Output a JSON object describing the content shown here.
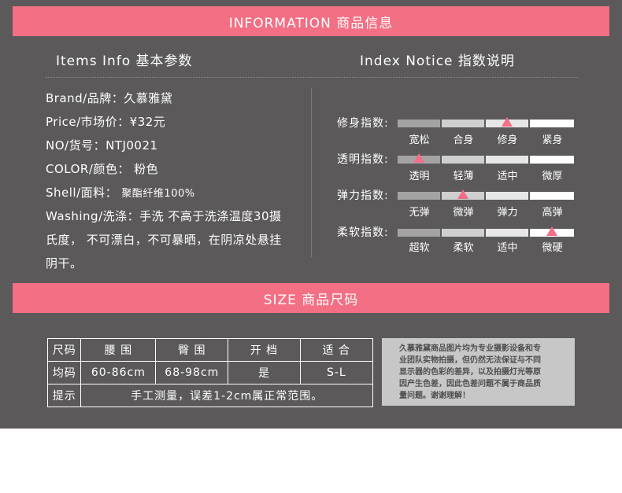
{
  "info_banner": "INFORMATION 商品信息",
  "items_info_title": "Items  Info  基本参数",
  "index_notice_title": "Index Notice  指数说明",
  "product": {
    "brand": "Brand/品牌：久慕雅黛",
    "price": "Price/市场价：¥32元",
    "no": "NO/货号：NTJ0021",
    "color": "COLOR/颜色：  粉色",
    "shell_label": "Shell/面料：  ",
    "shell_value": "聚酯纤维100%",
    "washing_1": "Washing/洗涤：手洗 不高于洗涤温度30摄",
    "washing_2": "氏度， 不可漂白，不可暴晒，在阴凉处悬挂",
    "washing_3": "阴干。"
  },
  "indices": [
    {
      "label": "修身指数:",
      "levels": [
        "宽松",
        "合身",
        "修身",
        "紧身"
      ],
      "selected": 2
    },
    {
      "label": "透明指数:",
      "levels": [
        "透明",
        "轻薄",
        "适中",
        "微厚"
      ],
      "selected": 0
    },
    {
      "label": "弹力指数:",
      "levels": [
        "无弹",
        "微弹",
        "弹力",
        "高弹"
      ],
      "selected": 1
    },
    {
      "label": "柔软指数:",
      "levels": [
        "超软",
        "柔软",
        "适中",
        "微硬"
      ],
      "selected": 3
    }
  ],
  "size_banner": "SIZE 商品尺码",
  "size_table": {
    "headers": [
      "尺码",
      "腰 围",
      "臀 围",
      "开 档",
      "适 合"
    ],
    "row": [
      "均码",
      "60-86cm",
      "68-98cm",
      "是",
      "S-L"
    ],
    "tip_label": "提示",
    "tip_text": "手工测量，误差1-2cm属正常范围。"
  },
  "notice_lines": [
    "久慕雅黛商品图片均为专业摄影设备和专",
    "业团队实物拍摄，但仍然无法保证与不同",
    "显示器的色彩的差异，以及拍摄灯光等原",
    "因产生色差，因此色差问题不属于商品质",
    "量问题。谢谢理解！"
  ],
  "colors": {
    "accent": "#f36f84",
    "panel": "#5b5959",
    "marker": "#f46e86"
  }
}
